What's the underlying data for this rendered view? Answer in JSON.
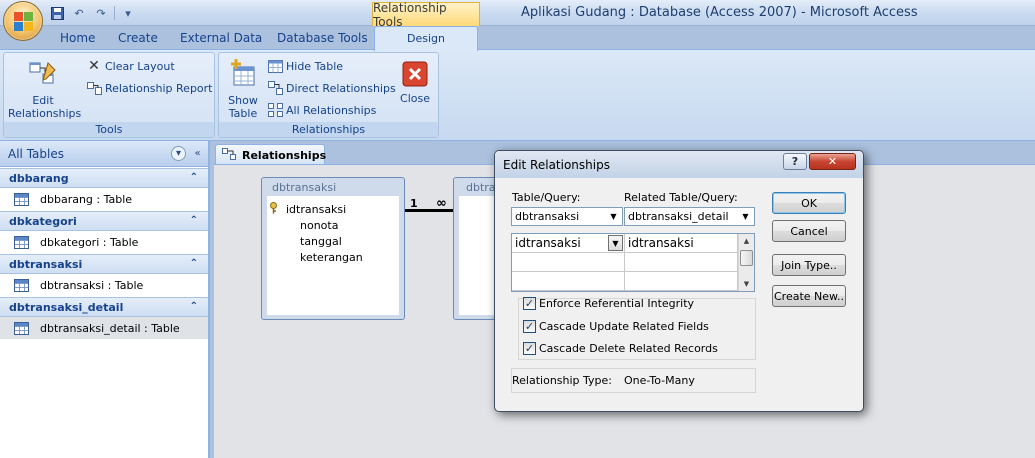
{
  "window": {
    "title": "Aplikasi Gudang : Database (Access 2007)  -  Microsoft Access",
    "context_tab_label": "Relationship Tools"
  },
  "quick_access": [
    "save-icon",
    "undo-icon",
    "redo-icon",
    "customize-icon"
  ],
  "ribbon": {
    "tabs": [
      "Home",
      "Create",
      "External Data",
      "Database Tools"
    ],
    "active_tab": "Design",
    "tools_group": {
      "label": "Tools",
      "edit_relationships": "Edit\nRelationships",
      "clear_layout": "Clear Layout",
      "relationship_report": "Relationship Report"
    },
    "relationships_group": {
      "label": "Relationships",
      "show_table": "Show\nTable",
      "hide_table": "Hide Table",
      "direct_relationships": "Direct Relationships",
      "all_relationships": "All Relationships",
      "close": "Close"
    }
  },
  "nav": {
    "header": "All Tables",
    "groups": [
      {
        "name": "dbbarang",
        "item": "dbbarang : Table"
      },
      {
        "name": "dbkategori",
        "item": "dbkategori : Table"
      },
      {
        "name": "dbtransaksi",
        "item": "dbtransaksi : Table"
      },
      {
        "name": "dbtransaksi_detail",
        "item": "dbtransaksi_detail : Table"
      }
    ]
  },
  "document": {
    "tab": "Relationships",
    "table1": {
      "title": "dbtransaksi",
      "fields": [
        "idtransaksi",
        "nonota",
        "tanggal",
        "keterangan"
      ]
    },
    "table2": {
      "title": "dbtra"
    },
    "relation": {
      "one": "1",
      "many": "∞"
    }
  },
  "dialog": {
    "title": "Edit Relationships",
    "help": "?",
    "close": "✕",
    "table_query_label": "Table/Query:",
    "related_label": "Related Table/Query:",
    "table_query_value": "dbtransaksi",
    "related_value": "dbtransaksi_detail",
    "grid_left": "idtransaksi",
    "grid_right": "idtransaksi",
    "enforce": "Enforce Referential Integrity",
    "cascade_update": "Cascade Update Related Fields",
    "cascade_delete": "Cascade Delete Related Records",
    "enforce_checked": true,
    "cascade_update_checked": true,
    "cascade_delete_checked": true,
    "rel_type_label": "Relationship Type:",
    "rel_type_value": "One-To-Many",
    "buttons": {
      "ok": "OK",
      "cancel": "Cancel",
      "join_type": "Join Type..",
      "create_new": "Create New.."
    }
  }
}
